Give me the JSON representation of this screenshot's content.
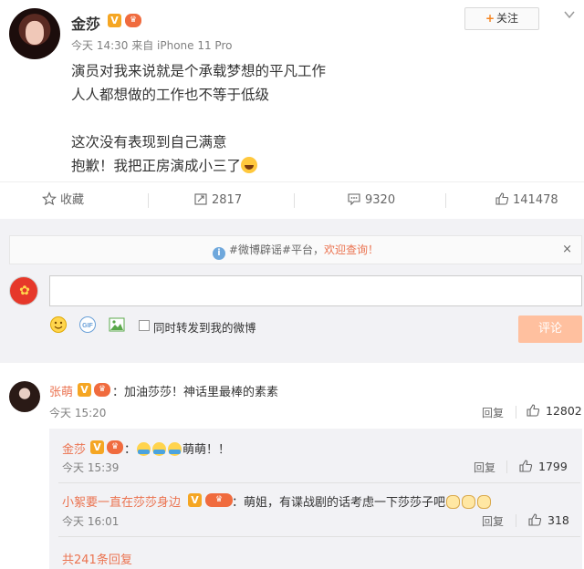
{
  "post": {
    "username": "金莎",
    "verified_badge": "V",
    "meta": "今天 14:30 来自 iPhone 11 Pro",
    "follow_label": "关注",
    "lines": [
      "演员对我来说就是个承载梦想的平凡工作",
      "人人都想做的工作也不等于低级",
      "",
      "这次没有表现到自己满意",
      "抱歉！我把正房演成小三了"
    ]
  },
  "actions": {
    "favorite": "收藏",
    "repost": "2817",
    "comment": "9320",
    "like": "141478"
  },
  "notice": {
    "prefix": "#微博辟谣#平台，",
    "link": "欢迎查询！",
    "close": "×"
  },
  "composer": {
    "repost_label": "同时转发到我的微博",
    "submit_label": "评论"
  },
  "comments": [
    {
      "name": "张萌",
      "text": "：加油莎莎！神话里最棒的素素",
      "time": "今天 15:20",
      "reply": "回复",
      "likes": "12802"
    }
  ],
  "replies": [
    {
      "name": "金莎",
      "text": "萌萌！！",
      "time": "今天 15:39",
      "reply": "回复",
      "likes": "1799"
    },
    {
      "name": "小絮要一直在莎莎身边",
      "text": "：萌姐，有谍战剧的话考虑一下莎莎子吧",
      "time": "今天 16:01",
      "reply": "回复",
      "likes": "318"
    }
  ],
  "all_replies": "共241条回复",
  "colors": {
    "accent": "#eb7350",
    "badge": "#f5a623",
    "submit": "#ffc09f"
  }
}
